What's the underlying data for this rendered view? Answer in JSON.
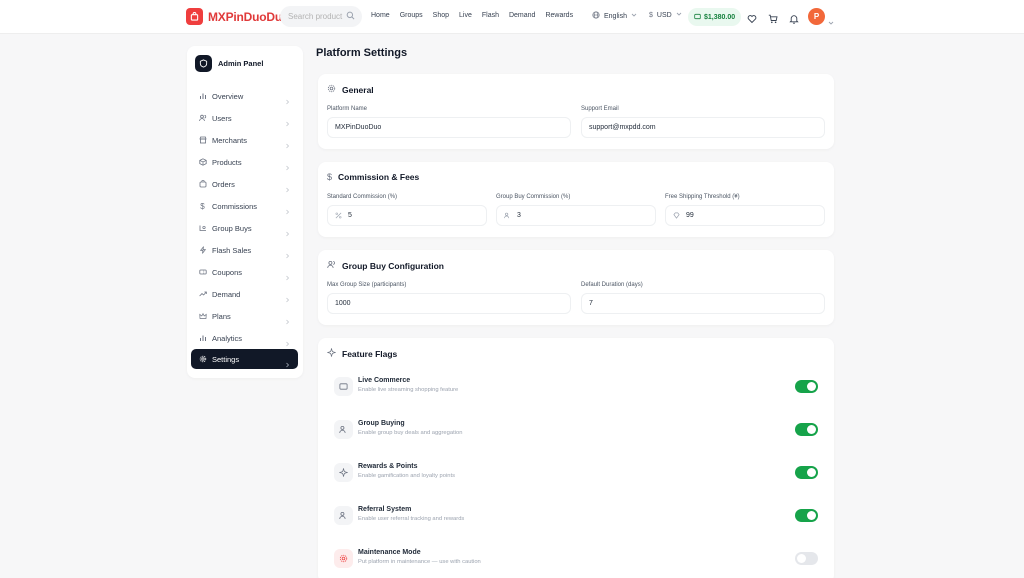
{
  "header": {
    "brand": "MXPinDuoDuo",
    "search_placeholder": "Search product",
    "nav": [
      "Home",
      "Groups",
      "Shop",
      "Live",
      "Flash",
      "Demand",
      "Rewards"
    ],
    "language": "English",
    "currency": "USD",
    "balance": "$1,380.00",
    "avatar_initial": "P"
  },
  "sidebar": {
    "title": "Admin Panel",
    "items": [
      {
        "label": "Overview",
        "icon": "bar-chart-icon"
      },
      {
        "label": "Users",
        "icon": "users-icon"
      },
      {
        "label": "Merchants",
        "icon": "store-icon"
      },
      {
        "label": "Products",
        "icon": "box-icon"
      },
      {
        "label": "Orders",
        "icon": "cart-icon"
      },
      {
        "label": "Commissions",
        "icon": "dollar-icon"
      },
      {
        "label": "Group Buys",
        "icon": "group-icon"
      },
      {
        "label": "Flash Sales",
        "icon": "lightning-icon"
      },
      {
        "label": "Coupons",
        "icon": "ticket-icon"
      },
      {
        "label": "Demand",
        "icon": "trend-icon"
      },
      {
        "label": "Plans",
        "icon": "crown-icon"
      },
      {
        "label": "Analytics",
        "icon": "bar-chart-icon"
      },
      {
        "label": "Settings",
        "icon": "gear-icon",
        "active": true
      }
    ]
  },
  "main": {
    "title": "Platform Settings",
    "general": {
      "title": "General",
      "platform_name_label": "Platform Name",
      "platform_name_value": "MXPinDuoDuo",
      "support_email_label": "Support Email",
      "support_email_value": "support@mxpdd.com"
    },
    "commission": {
      "title": "Commission & Fees",
      "standard_label": "Standard Commission (%)",
      "standard_value": "5",
      "group_label": "Group Buy Commission (%)",
      "group_value": "3",
      "shipping_label": "Free Shipping Threshold (¥)",
      "shipping_value": "99"
    },
    "group_buy": {
      "title": "Group Buy Configuration",
      "max_size_label": "Max Group Size (participants)",
      "max_size_value": "1000",
      "duration_label": "Default Duration (days)",
      "duration_value": "7"
    },
    "flags": {
      "title": "Feature Flags",
      "items": [
        {
          "name": "Live Commerce",
          "desc": "Enable live streaming shopping feature",
          "on": true,
          "icon": "tv-icon"
        },
        {
          "name": "Group Buying",
          "desc": "Enable group buy deals and aggregation",
          "on": true,
          "icon": "users-icon"
        },
        {
          "name": "Rewards & Points",
          "desc": "Enable gamification and loyalty points",
          "on": true,
          "icon": "sparkle-icon"
        },
        {
          "name": "Referral System",
          "desc": "Enable user referral tracking and rewards",
          "on": true,
          "icon": "users-icon"
        },
        {
          "name": "Maintenance Mode",
          "desc": "Put platform in maintenance — use with caution",
          "on": false,
          "icon": "gear-icon"
        }
      ]
    }
  },
  "colors": {
    "brand": "#e03a3a",
    "toggle_on": "#16a34a",
    "sidebar_active": "#111827",
    "balance_bg": "#e9f8ef"
  }
}
